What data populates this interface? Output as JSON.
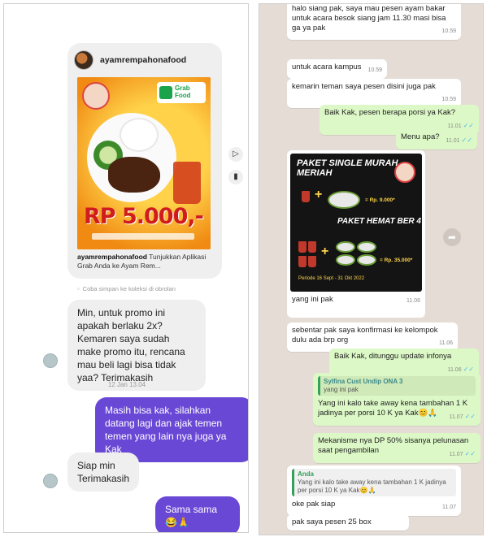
{
  "instagram": {
    "post": {
      "username": "ayamrempahonafood",
      "grab_label": "Grab Food",
      "price": "RP 5.000,-",
      "caption_user": "ayamrempahonafood",
      "caption_text": " Tunjukkan Aplikasi Grab Anda ke Ayam Rem..."
    },
    "save_hint": "Coba simpan ke koleksi di obrolan",
    "messages": [
      {
        "dir": "in",
        "text": "Min, untuk promo ini apakah berlaku 2x? Kemaren saya sudah make promo itu, rencana mau beli lagi bisa tidak yaa? Terimakasih"
      },
      {
        "dir": "time",
        "text": "12 Jan 13.04"
      },
      {
        "dir": "out",
        "text": "Masih bisa kak, silahkan datang lagi dan ajak temen temen yang lain nya juga ya Kak"
      },
      {
        "dir": "in",
        "text": "Siap min Terimakasih"
      },
      {
        "dir": "out",
        "text": "Sama sama 😂🙏"
      }
    ]
  },
  "whatsapp": {
    "m1": {
      "text": "halo siang pak, saya mau pesen ayam bakar untuk acara besok siang jam 11.30 masi bisa ga ya pak",
      "time": "10.59"
    },
    "m2": {
      "text": "untuk acara kampus",
      "time": "10.59"
    },
    "m3": {
      "text": "kemarin teman saya pesen disini juga pak",
      "time": "10.59"
    },
    "m4": {
      "text": "Baik Kak, pesen berapa porsi ya Kak?",
      "time": "11.01"
    },
    "m5": {
      "text": "Menu apa?",
      "time": "11.01"
    },
    "promo": {
      "title1": "PAKET SINGLE MURAH MERIAH",
      "price1": "= Rp. 9.000*",
      "title2": "PAKET HEMAT BER 4",
      "price2": "= Rp. 35.000*",
      "period": "Periode 16 Sept - 31 Okt 2022",
      "caption": "yang ini pak",
      "time": "11.06"
    },
    "m6": {
      "text": "sebentar pak saya konfirmasi ke kelompok dulu ada brp org",
      "time": "11.06"
    },
    "m7": {
      "text": "Baik Kak, ditunggu update infonya",
      "time": "11.06"
    },
    "m8": {
      "quote_who": "Sylfina Cust Undip ONA 3",
      "quote_text": "yang ini pak",
      "text": "Yang ini kalo take away kena tambahan 1 K jadinya per porsi 10 K ya Kak😊🙏",
      "time": "11.07"
    },
    "m9": {
      "text": "Mekanisme nya DP 50% sisanya pelunasan saat pengambilan",
      "time": "11.07"
    },
    "m10": {
      "quote_who": "Anda",
      "quote_text": "Yang ini kalo take away kena tambahan 1 K jadinya per porsi 10 K ya Kak😊🙏",
      "text": "oke pak siap",
      "time": "11.07"
    },
    "m11": {
      "text": "pak saya pesen 25 box"
    }
  }
}
